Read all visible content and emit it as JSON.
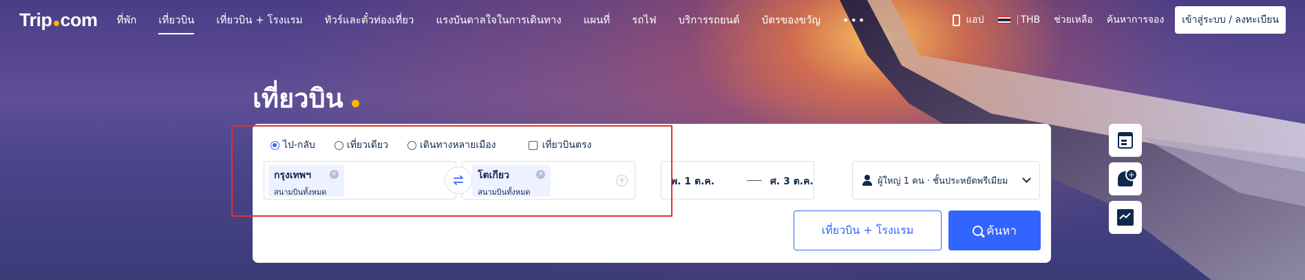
{
  "brand": {
    "logo_left": "Trip",
    "logo_right": "com",
    "accent": "#ffb400"
  },
  "nav": {
    "items": [
      {
        "label": "ที่พัก",
        "active": false
      },
      {
        "label": "เที่ยวบิน",
        "active": true
      },
      {
        "label": "เที่ยวบิน + โรงแรม",
        "active": false
      },
      {
        "label": "ทัวร์และตั๋วท่องเที่ยว",
        "active": false
      },
      {
        "label": "แรงบันดาลใจในการเดินทาง",
        "active": false
      },
      {
        "label": "แผนที่",
        "active": false
      },
      {
        "label": "รถไฟ",
        "active": false
      },
      {
        "label": "บริการรถยนต์",
        "active": false
      },
      {
        "label": "บัตรของขวัญ",
        "active": false
      }
    ],
    "more": "•••",
    "app_label": "แอป",
    "currency": "THB",
    "help": "ช่วยเหลือ",
    "find_booking": "ค้นหาการจอง",
    "login": "เข้าสู่ระบบ / ลงทะเบียน"
  },
  "hero": {
    "title": "เที่ยวบิน"
  },
  "search": {
    "trip_types": [
      "ไป-กลับ",
      "เที่ยวเดียว",
      "เดินทางหลายเมือง"
    ],
    "selected_trip_type": "ไป-กลับ",
    "direct_label": "เที่ยวบินตรง",
    "from_city": "กรุงเทพฯ",
    "from_sub": "สนามบินทั้งหมด",
    "to_city": "โตเกียว",
    "to_sub": "สนามบินทั้งหมด",
    "depart_date": "พ. 1 ต.ค.",
    "return_date": "ศ. 3 ต.ค.",
    "passengers": "ผู้ใหญ่ 1 คน · ชั้นประหยัดพรีเมียม",
    "combo_button": "เที่ยวบิน + โรงแรม",
    "search_button": "ค้นหา",
    "primary_color": "#3264ff"
  },
  "side_tools": [
    "calendar-icon",
    "price-alert-icon",
    "price-trend-icon"
  ],
  "highlight_color": "#e0302d"
}
